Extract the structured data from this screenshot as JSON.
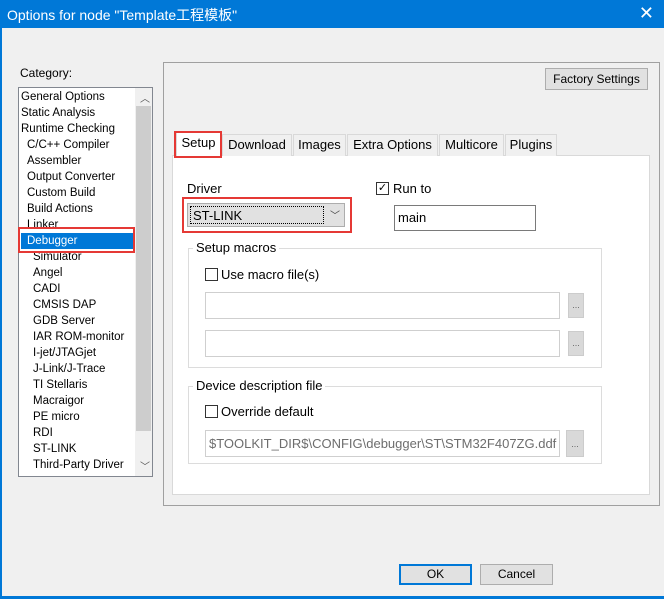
{
  "window": {
    "title": "Options for node \"Template工程模板\"",
    "close": "✕"
  },
  "category": {
    "label": "Category:",
    "items": [
      {
        "label": "General Options",
        "sub": false
      },
      {
        "label": "Static Analysis",
        "sub": false
      },
      {
        "label": "Runtime Checking",
        "sub": false
      },
      {
        "label": "C/C++ Compiler",
        "sub": true
      },
      {
        "label": "Assembler",
        "sub": true
      },
      {
        "label": "Output Converter",
        "sub": true
      },
      {
        "label": "Custom Build",
        "sub": true
      },
      {
        "label": "Build Actions",
        "sub": true
      },
      {
        "label": "Linker",
        "sub": true
      },
      {
        "label": "Debugger",
        "sub": true,
        "selected": true
      },
      {
        "label": "Simulator",
        "sub": true,
        "deep": true
      },
      {
        "label": "Angel",
        "sub": true,
        "deep": true
      },
      {
        "label": "CADI",
        "sub": true,
        "deep": true
      },
      {
        "label": "CMSIS DAP",
        "sub": true,
        "deep": true
      },
      {
        "label": "GDB Server",
        "sub": true,
        "deep": true
      },
      {
        "label": "IAR ROM-monitor",
        "sub": true,
        "deep": true
      },
      {
        "label": "I-jet/JTAGjet",
        "sub": true,
        "deep": true
      },
      {
        "label": "J-Link/J-Trace",
        "sub": true,
        "deep": true
      },
      {
        "label": "TI Stellaris",
        "sub": true,
        "deep": true
      },
      {
        "label": "Macraigor",
        "sub": true,
        "deep": true
      },
      {
        "label": "PE micro",
        "sub": true,
        "deep": true
      },
      {
        "label": "RDI",
        "sub": true,
        "deep": true
      },
      {
        "label": "ST-LINK",
        "sub": true,
        "deep": true
      },
      {
        "label": "Third-Party Driver",
        "sub": true,
        "deep": true
      }
    ]
  },
  "factory_settings": "Factory Settings",
  "tabs": [
    "Setup",
    "Download",
    "Images",
    "Extra Options",
    "Multicore",
    "Plugins"
  ],
  "setup": {
    "driver_label": "Driver",
    "driver_value": "ST-LINK",
    "run_to_label": "Run to",
    "run_to_checked": true,
    "run_to_value": "main",
    "macros_title": "Setup macros",
    "use_macro_label": "Use macro file(s)",
    "macro_file_1": "",
    "macro_file_2": "",
    "device_title": "Device description file",
    "override_label": "Override default",
    "device_path": "$TOOLKIT_DIR$\\CONFIG\\debugger\\ST\\STM32F407ZG.ddf",
    "browse": "..."
  },
  "buttons": {
    "ok": "OK",
    "cancel": "Cancel"
  }
}
